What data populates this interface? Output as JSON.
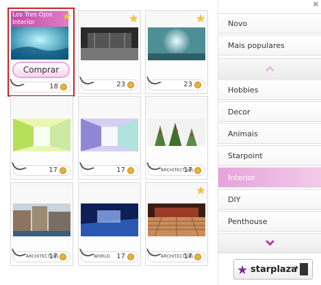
{
  "cards": [
    {
      "title": "Los Tres Ojos Interior",
      "price": "18",
      "buy_label": "Comprar",
      "brand": "",
      "starred": true
    },
    {
      "title": "",
      "price": "23",
      "brand": "",
      "starred": true
    },
    {
      "title": "",
      "price": "23",
      "brand": "",
      "starred": true
    },
    {
      "title": "",
      "price": "17",
      "brand": "",
      "starred": false
    },
    {
      "title": "",
      "price": "17",
      "brand": "",
      "starred": false
    },
    {
      "title": "",
      "price": "17",
      "brand": "ARCHITECTUAL",
      "starred": false
    },
    {
      "title": "",
      "price": "17",
      "brand": "ARCHITECTUAL",
      "starred": false
    },
    {
      "title": "",
      "price": "17",
      "brand": "WORLD",
      "starred": false
    },
    {
      "title": "",
      "price": "17",
      "brand": "ARCHITECTUAL",
      "starred": true
    }
  ],
  "sidebar": {
    "items": [
      {
        "label": "Novo"
      },
      {
        "label": "Mais populares"
      },
      {
        "label": "Hobbies"
      },
      {
        "label": "Decor"
      },
      {
        "label": "Animais"
      },
      {
        "label": "Starpoint"
      },
      {
        "label": "Interior"
      },
      {
        "label": "DIY"
      },
      {
        "label": "Penthouse"
      }
    ],
    "active": "Interior",
    "logo_text": "starplaza"
  },
  "colors": {
    "accent": "#c03aa1",
    "selected_border": "#cc1f24",
    "coin": "#e7b23a"
  }
}
